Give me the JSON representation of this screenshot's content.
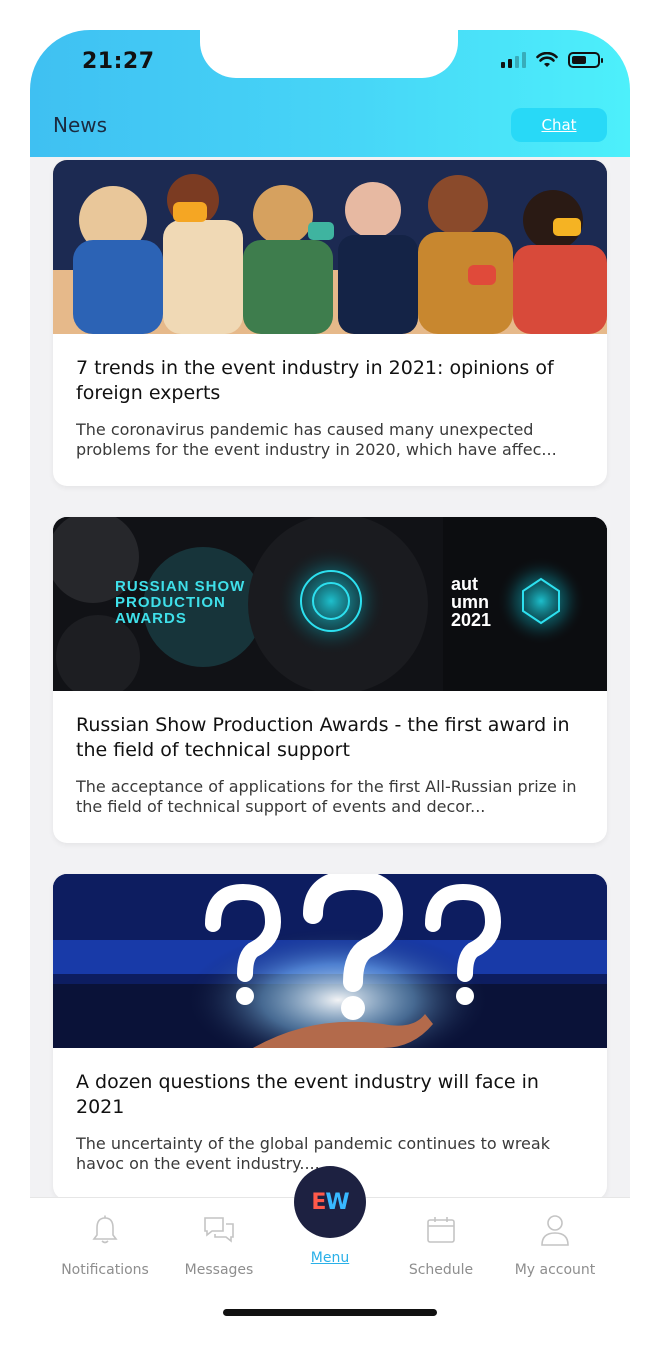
{
  "status_bar": {
    "time": "21:27"
  },
  "header": {
    "title": "News",
    "chat_label": "Chat"
  },
  "articles": [
    {
      "title": "7 trends in the event industry in 2021: opinions of foreign experts",
      "excerpt": "The coronavirus pandemic has caused many unexpected problems for the event industry in 2020, which have affec..."
    },
    {
      "title": "Russian Show Production Awards - the first award in the field of technical support",
      "excerpt": "The acceptance of applications for the first All-Russian prize in the field of technical support of events and decor...",
      "image_text": {
        "line1": "RUSSIAN SHOW",
        "line2": "PRODUCTION",
        "line3": "AWARDS",
        "season1": "aut",
        "season2": "umn",
        "year": "2021"
      }
    },
    {
      "title": "A dozen questions the event industry will face in 2021",
      "excerpt": "The uncertainty of the global pandemic continues to wreak havoc on the event industry...."
    }
  ],
  "bottom_nav": {
    "items": [
      {
        "label": "Notifications",
        "icon": "bell-icon"
      },
      {
        "label": "Messages",
        "icon": "messages-icon"
      },
      {
        "label": "Menu",
        "icon": "ew-logo"
      },
      {
        "label": "Schedule",
        "icon": "calendar-icon"
      },
      {
        "label": "My account",
        "icon": "user-icon"
      }
    ],
    "menu_logo": {
      "e": "E",
      "w": "W"
    }
  },
  "colors": {
    "header_gradient_start": "#3fc0f2",
    "header_gradient_end": "#4df0fb",
    "chat_button": "#28d9f7",
    "menu_circle": "#1d2141",
    "menu_label": "#2ab0e8",
    "nav_label": "#8e8e8e"
  }
}
